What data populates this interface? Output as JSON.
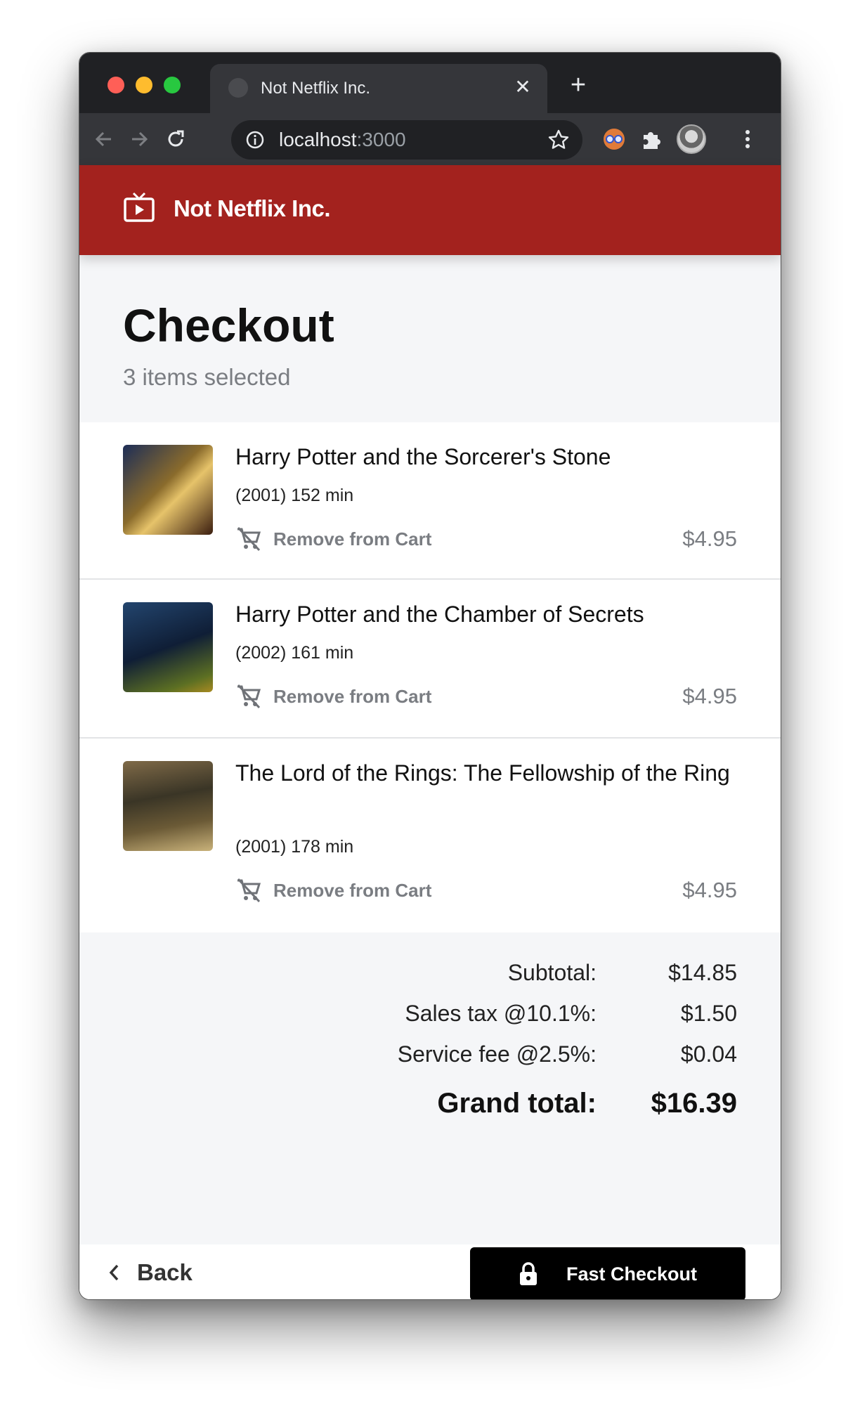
{
  "browser": {
    "tab_title": "Not Netflix Inc.",
    "tab_close": "✕",
    "new_tab": "+",
    "url_host": "localhost",
    "url_port": ":3000"
  },
  "app": {
    "brand": "Not Netflix Inc.",
    "brand_color": "#a3221e"
  },
  "checkout": {
    "title": "Checkout",
    "subtitle": "3 items selected",
    "remove_label": "Remove from Cart",
    "items": [
      {
        "title": "Harry Potter and the Sorcerer's Stone",
        "meta": "(2001) 152 min",
        "price": "$4.95"
      },
      {
        "title": "Harry Potter and the Chamber of Secrets",
        "meta": "(2002) 161 min",
        "price": "$4.95"
      },
      {
        "title": "The Lord of the Rings: The Fellowship of the Ring",
        "meta": "(2001) 178 min",
        "price": "$4.95"
      }
    ]
  },
  "totals": {
    "subtotal_label": "Subtotal:",
    "subtotal": "$14.85",
    "tax_label": "Sales tax @10.1%:",
    "tax": "$1.50",
    "fee_label": "Service fee @2.5%:",
    "fee": "$0.04",
    "grand_label": "Grand total:",
    "grand": "$16.39"
  },
  "footer": {
    "back_label": "Back",
    "checkout_label": "Fast Checkout"
  }
}
